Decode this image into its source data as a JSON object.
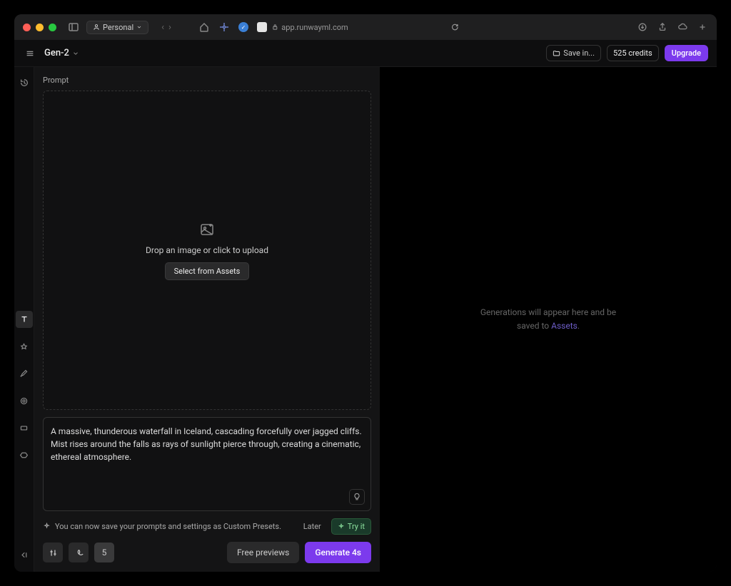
{
  "browser": {
    "workspace": "Personal",
    "url": "app.runwayml.com"
  },
  "app": {
    "title": "Gen-2",
    "save_label": "Save in...",
    "credits": "525 credits",
    "upgrade": "Upgrade"
  },
  "panel": {
    "prompt_label": "Prompt",
    "dropzone_text": "Drop an image or click to upload",
    "select_assets": "Select from Assets",
    "prompt_value": "A massive, thunderous waterfall in Iceland, cascading forcefully over jagged cliffs. Mist rises around the falls as rays of sunlight pierce through, creating a cinematic, ethereal atmosphere.",
    "tip_text": "You can now save your prompts and settings as Custom Presets.",
    "later": "Later",
    "tryit": "Try it",
    "count": "5",
    "free_previews": "Free previews",
    "generate": "Generate 4s"
  },
  "empty": {
    "line1": "Generations will appear here and be",
    "line2_prefix": "saved to ",
    "assets": "Assets"
  }
}
